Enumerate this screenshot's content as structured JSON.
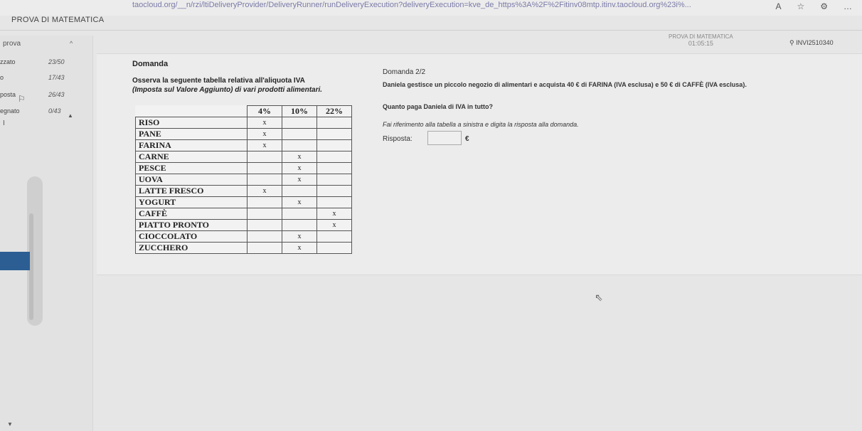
{
  "browser": {
    "url": "taocloud.org/__n/rzi/ltiDeliveryProvider/DeliveryRunner/runDeliveryExecution?deliveryExecution=kve_de_https%3A%2F%2Fitinv08mtp.itinv.taocloud.org%23i%...",
    "icons": [
      "A",
      "☆",
      "⚙",
      "…"
    ]
  },
  "app": {
    "title": "PROVA DI MATEMATICA",
    "header_title": "PROVA DI MATEMATICA",
    "timer": "01:05:15",
    "user_id": "INVI2510340"
  },
  "sidebar": {
    "heading": "prova",
    "rows": [
      {
        "label": "zzato",
        "count": "23/50"
      },
      {
        "label": "o",
        "count": "17/43"
      },
      {
        "label": "posta",
        "count": "26/43"
      },
      {
        "label": "egnato",
        "count": "0/43"
      }
    ]
  },
  "question_panel": {
    "heading": "Domanda",
    "intro_line1": "Osserva la seguente tabella relativa all'aliquota IVA",
    "intro_line2": "(Imposta sul Valore Aggiunto) di vari prodotti alimentari.",
    "table": {
      "headers": [
        "4%",
        "10%",
        "22%"
      ],
      "rows": [
        {
          "product": "RISO",
          "marks": [
            "x",
            "",
            ""
          ]
        },
        {
          "product": "PANE",
          "marks": [
            "x",
            "",
            ""
          ]
        },
        {
          "product": "FARINA",
          "marks": [
            "x",
            "",
            ""
          ]
        },
        {
          "product": "CARNE",
          "marks": [
            "",
            "x",
            ""
          ]
        },
        {
          "product": "PESCE",
          "marks": [
            "",
            "x",
            ""
          ]
        },
        {
          "product": "UOVA",
          "marks": [
            "",
            "x",
            ""
          ]
        },
        {
          "product": "LATTE FRESCO",
          "marks": [
            "x",
            "",
            ""
          ]
        },
        {
          "product": "YOGURT",
          "marks": [
            "",
            "x",
            ""
          ]
        },
        {
          "product": "CAFFÈ",
          "marks": [
            "",
            "",
            "x"
          ]
        },
        {
          "product": "PIATTO PRONTO",
          "marks": [
            "",
            "",
            "x"
          ]
        },
        {
          "product": "CIOCCOLATO",
          "marks": [
            "",
            "x",
            ""
          ]
        },
        {
          "product": "ZUCCHERO",
          "marks": [
            "",
            "x",
            ""
          ]
        }
      ]
    },
    "question_number": "Domanda 2/2",
    "question_text": "Daniela gestisce un piccolo negozio di alimentari e acquista 40 € di FARINA (IVA esclusa) e 50 € di CAFFÈ (IVA esclusa).",
    "question_ask": "Quanto paga Daniela di IVA in tutto?",
    "hint": "Fai riferimento alla tabella a sinistra e digita la risposta alla domanda.",
    "answer_label": "Risposta:",
    "answer_value": "",
    "currency": "€"
  }
}
